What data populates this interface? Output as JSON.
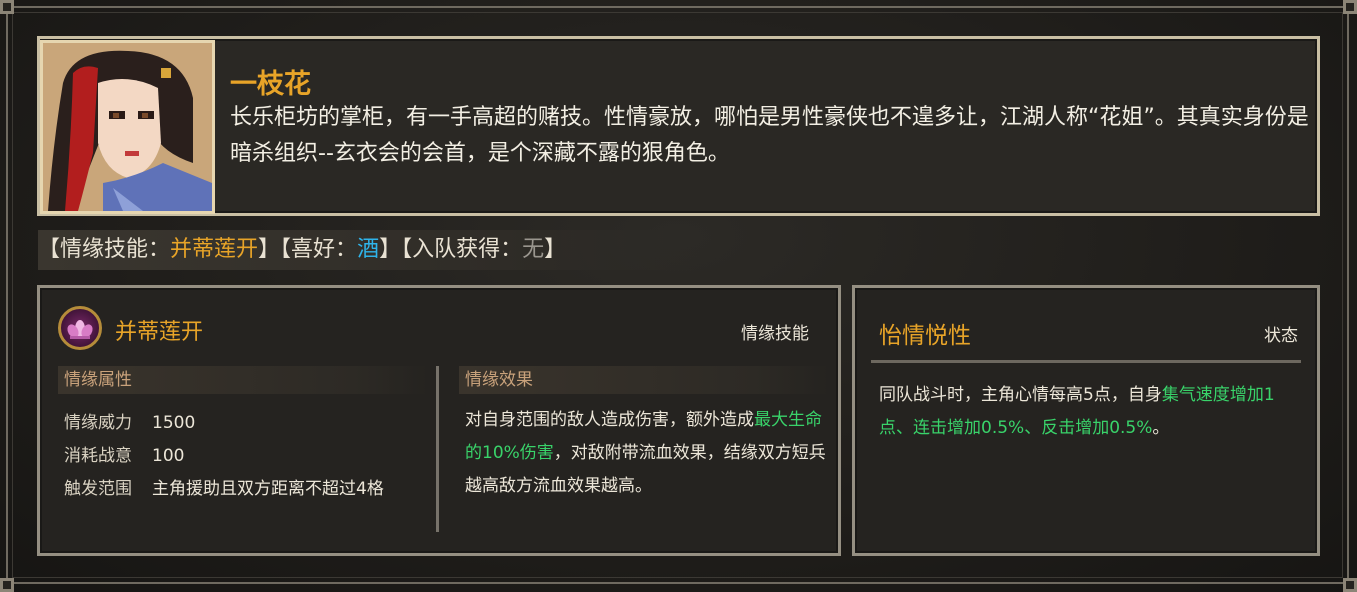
{
  "character": {
    "name": "一枝花",
    "bio": "长乐柜坊的掌柜，有一手高超的赌技。性情豪放，哪怕是男性豪侠也不遑多让，江湖人称“花姐”。其真实身份是暗杀组织--玄衣会的会首，是个深藏不露的狠角色。"
  },
  "info": {
    "skill_prefix": "【情缘技能：",
    "skill_value": "并蒂莲开",
    "skill_suffix": "】",
    "like_prefix": "【喜好：",
    "like_value": "酒",
    "like_suffix": "】",
    "join_prefix": "【入队获得：",
    "join_value": "无",
    "join_suffix": "】"
  },
  "skill": {
    "icon": "lotus-icon",
    "title": "并蒂莲开",
    "type": "情缘技能",
    "attr_header": "情缘属性",
    "effect_header": "情缘效果",
    "attributes": [
      {
        "key": "情缘威力",
        "value": "1500"
      },
      {
        "key": "消耗战意",
        "value": "100"
      },
      {
        "key": "触发范围",
        "value": "主角援助且双方距离不超过4格"
      }
    ],
    "effect_parts": {
      "a": "对自身范围的敌人造成伤害，额外造成",
      "b": "最大生命的10%伤害",
      "c": "，对敌附带流血效果，结缘双方短兵越高敌方流血效果越高。"
    }
  },
  "status": {
    "title": "怡情悦性",
    "type": "状态",
    "text_parts": {
      "a": "同队战斗时，主角心情每高5点，自身",
      "b": "集气速度增加1点、连击增加0.5%、反击增加0.5%",
      "c": "。"
    }
  },
  "colors": {
    "accent_gold": "#e8a428",
    "highlight_cyan": "#2fb4ea",
    "highlight_green": "#39d36a",
    "muted_grey": "#9a968e"
  }
}
